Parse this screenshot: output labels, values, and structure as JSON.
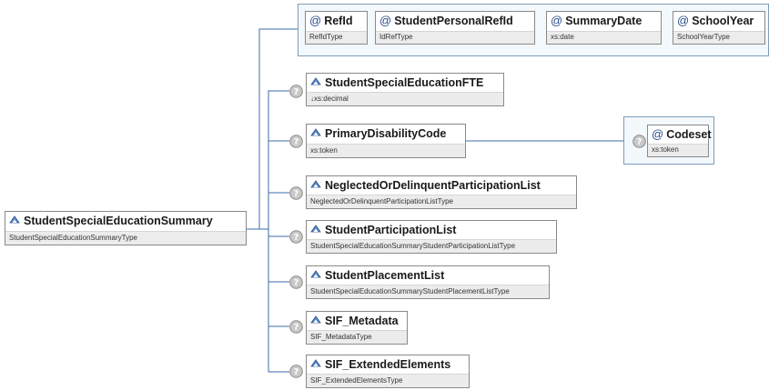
{
  "root": {
    "name": "StudentSpecialEducationSummary",
    "type": "StudentSpecialEducationSummaryType"
  },
  "attributes": [
    {
      "name": "RefId",
      "type": "RefIdType"
    },
    {
      "name": "StudentPersonalRefId",
      "type": "IdRefType"
    },
    {
      "name": "SummaryDate",
      "type": "xs:date"
    },
    {
      "name": "SchoolYear",
      "type": "SchoolYearType"
    }
  ],
  "children": [
    {
      "name": "StudentSpecialEducationFTE",
      "type": "↓xs:decimal"
    },
    {
      "name": "PrimaryDisabilityCode",
      "type": "xs:token"
    },
    {
      "name": "NeglectedOrDelinquentParticipationList",
      "type": "NeglectedOrDelinquentParticipationListType"
    },
    {
      "name": "StudentParticipationList",
      "type": "StudentSpecialEducationSummaryStudentParticipationListType"
    },
    {
      "name": "StudentPlacementList",
      "type": "StudentSpecialEducationSummaryStudentPlacementListType"
    },
    {
      "name": "SIF_Metadata",
      "type": "SIF_MetadataType"
    },
    {
      "name": "SIF_ExtendedElements",
      "type": "SIF_ExtendedElementsType"
    }
  ],
  "codeset_attribute": {
    "name": "Codeset",
    "type": "xs:token"
  },
  "colors": {
    "connector": "#3d6ea8",
    "box_border": "#8a8a8a",
    "type_bar": "#ececec",
    "attr_frame": "#7f9db9"
  }
}
